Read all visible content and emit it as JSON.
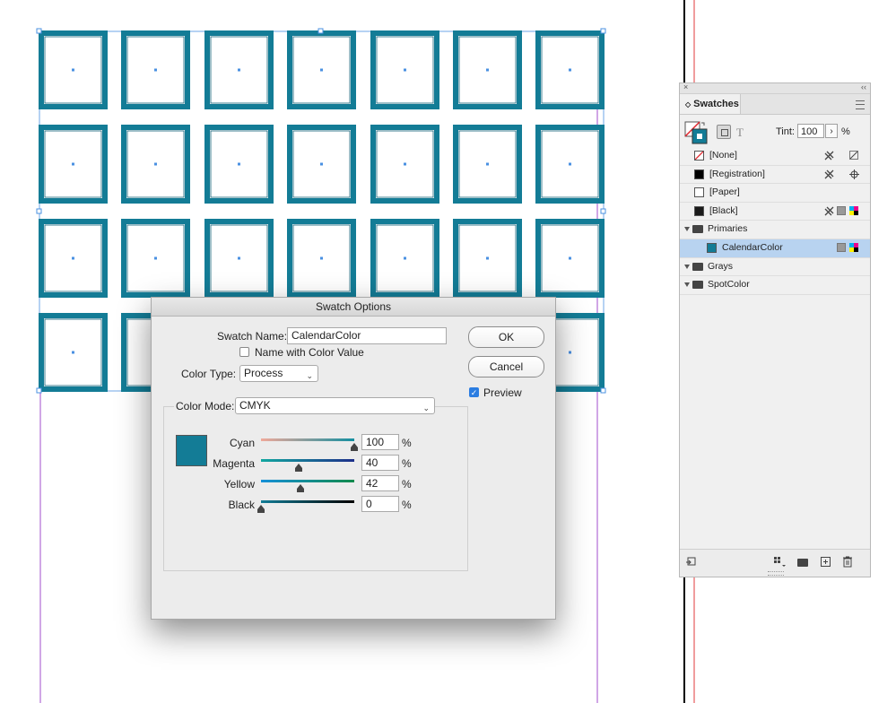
{
  "canvas": {
    "frame_color": "#137c96",
    "grid_rows": 4,
    "grid_cols": 7
  },
  "swatches_panel": {
    "close_glyph": "×",
    "collapse_glyph": "‹‹",
    "tab_label": "Swatches",
    "tab_glyph": "◇",
    "tint_label": "Tint:",
    "tint_value": "100",
    "tint_arrow": "›",
    "tint_unit": "%",
    "text_mode_glyph": "T",
    "swatches": [
      {
        "name": "[None]",
        "chip": "none"
      },
      {
        "name": "[Registration]",
        "chip": "#000000"
      },
      {
        "name": "[Paper]",
        "chip": "#ffffff"
      },
      {
        "name": "[Black]",
        "chip": "#1a1a1a"
      }
    ],
    "groups": [
      {
        "name": "Primaries",
        "expanded": true,
        "items": [
          {
            "name": "CalendarColor",
            "chip": "#137c96",
            "selected": true
          }
        ]
      },
      {
        "name": "Grays",
        "expanded": false,
        "items": []
      },
      {
        "name": "SpotColor",
        "expanded": false,
        "items": []
      }
    ]
  },
  "dialog": {
    "title": "Swatch Options",
    "swatch_name_label": "Swatch Name:",
    "swatch_name_value": "CalendarColor",
    "name_with_color_value_label": "Name with Color Value",
    "color_type_label": "Color Type:",
    "color_type_value": "Process",
    "color_mode_label": "Color Mode:",
    "color_mode_value": "CMYK",
    "ok_label": "OK",
    "cancel_label": "Cancel",
    "preview_label": "Preview",
    "preview_checked": true,
    "preview_swatch_color": "#137c96",
    "percent_unit": "%",
    "channels": [
      {
        "label": "Cyan",
        "value": "100",
        "fraction": 1.0,
        "gradient": "linear-gradient(90deg,#f0a99a,#148fa0)"
      },
      {
        "label": "Magenta",
        "value": "40",
        "fraction": 0.4,
        "gradient": "linear-gradient(90deg,#12a7a0,#1d2f8a)"
      },
      {
        "label": "Yellow",
        "value": "42",
        "fraction": 0.42,
        "gradient": "linear-gradient(90deg,#1690d8,#118a4c)"
      },
      {
        "label": "Black",
        "value": "0",
        "fraction": 0.0,
        "gradient": "linear-gradient(90deg,#127c96,#000000)"
      }
    ]
  }
}
